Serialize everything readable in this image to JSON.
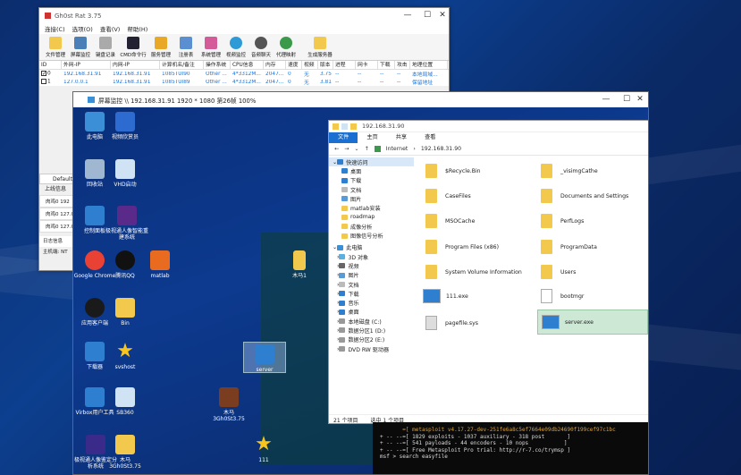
{
  "ghost": {
    "title": "Gh0st Rat 3.75",
    "menu": [
      "连接(C)",
      "选项(O)",
      "查看(V)",
      "帮助(H)"
    ],
    "toolbar": [
      "文件管理",
      "屏幕监控",
      "键盘记录",
      "CMD命令行",
      "服务管理",
      "注册表",
      "系统管理",
      "视频监控",
      "音频聊天",
      "代理映射",
      "生成服务器"
    ],
    "columns": [
      "ID",
      "外网-IP",
      "内网-IP",
      "计算机名/备注",
      "操作系统",
      "CPU信息",
      "内存",
      "速度",
      "视频",
      "版本",
      "进程",
      "网卡",
      "下载",
      "攻击",
      "地理位置"
    ],
    "rows": [
      [
        "0",
        "192.168.31.91",
        "192.168.31.91",
        "1085TUI90",
        "Other ...",
        "4*3312M...",
        "2047...",
        "0",
        "无",
        "3.75",
        "--",
        "--",
        "--",
        "--",
        "本地局域..."
      ],
      [
        "1",
        "127.0.0.1",
        "192.168.31.91",
        "1085TUI89",
        "Other ...",
        "4*3312M...",
        "2047...",
        "0",
        "无",
        "3.81",
        "--",
        "--",
        "--",
        "--",
        "保留地址"
      ]
    ],
    "side_labels": [
      "Default",
      "上线信息",
      "肉鸡0",
      "肉鸡0",
      "肉鸡0",
      "日志信息",
      "主机端:",
      "NT"
    ],
    "side_values": [
      "192",
      "127.0",
      "127.0"
    ]
  },
  "monitor": {
    "title": "屏幕监控 \\\\ 192.168.31.91  1920 * 1080 第26帧 100%",
    "icons": [
      {
        "label": "此电脑",
        "color": "#3a8fd6"
      },
      {
        "label": "视频欣赏员",
        "color": "#2d6bd1"
      },
      {
        "label": "回收站",
        "color": "#9fb7d0"
      },
      {
        "label": "VHD启动",
        "color": "#cfe3f5"
      },
      {
        "label": "控制面板",
        "color": "#2f7fd1"
      },
      {
        "label": "极视通人像智能重建系统",
        "color": "#5a2a8a"
      },
      {
        "label": "Google Chrome",
        "color": "#e94235"
      },
      {
        "label": "腾讯QQ",
        "color": "#111111"
      },
      {
        "label": "matlab",
        "color": "#e86b1f"
      },
      {
        "label": "应用客户端",
        "color": "#1a1a1a"
      },
      {
        "label": "Bin",
        "color": "#f3c94d"
      },
      {
        "label": "下载器",
        "color": "#2f7fd1"
      },
      {
        "label": "svshost",
        "color": "#f7c51e"
      },
      {
        "label": "Virbox用户工具",
        "color": "#2f7fd1"
      },
      {
        "label": "SB360",
        "color": "#cfe3f5"
      },
      {
        "label": "木马 3Gh0St3.75",
        "color": "#7a3d1f"
      },
      {
        "label": "极视通人像鉴定分析系统",
        "color": "#3a2a8a"
      },
      {
        "label": "木马 3Gh0St3.75",
        "color": "#f3c94d"
      },
      {
        "label": "111",
        "color": "#f7c51e"
      },
      {
        "label": "server",
        "color": "#2f7fd1"
      },
      {
        "label": "木马1",
        "color": "#f3c94d"
      }
    ]
  },
  "explorer": {
    "title": "192.168.31.90",
    "tabs": [
      "文件",
      "主页",
      "共享",
      "查看"
    ],
    "path": [
      "Internet",
      "192.168.31.90"
    ],
    "nav": [
      "快速访问",
      "桌面",
      "下载",
      "文档",
      "图片",
      "matlab安装",
      "roadmap",
      "成像分析",
      "图像信号分析",
      "此电脑",
      "3D 对象",
      "视频",
      "图片",
      "文档",
      "下载",
      "音乐",
      "桌面",
      "本地磁盘 (C:)",
      "数据分区1 (D:)",
      "数据分区2 (E:)",
      "DVD RW 驱动器"
    ],
    "files_left": [
      "$Recycle.Bin",
      "CaseFiles",
      "MSOCache",
      "Program Files (x86)",
      "System Volume Information",
      "111.exe",
      "pagefile.sys"
    ],
    "files_right": [
      "_visimgCathe",
      "Documents and Settings",
      "PerfLogs",
      "ProgramData",
      "Users",
      "bootmgr",
      "server.exe"
    ],
    "status_count": "21 个项目",
    "status_selected": "选中 1 个项目"
  },
  "terminal": {
    "lines": [
      "       =[ metasploit v4.17.27-dev-251fe6a8c5ef7664e09db24690f199cef97c1bc",
      "+ -- --=[ 1829 exploits - 1037 auxiliary - 318 post       ]",
      "+ -- --=[ 541 payloads - 44 encoders - 10 nops           ]",
      "+ -- --=[ Free Metasploit Pro trial: http://r-7.co/trymsp ]",
      "",
      "msf > search easyfile"
    ]
  }
}
